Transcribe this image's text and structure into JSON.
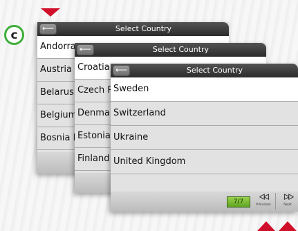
{
  "step_label": "c",
  "back_glyph": "⟵",
  "panels": [
    {
      "title": "Select Country",
      "rows": [
        "Andorra",
        "Austria",
        "Belarus",
        "Belgium",
        "Bosnia I"
      ]
    },
    {
      "title": "Select Country",
      "rows": [
        "Croatia",
        "Czech R",
        "Denmar",
        "Estonia",
        "Finland"
      ]
    },
    {
      "title": "Select Country",
      "rows": [
        "Sweden",
        "Switzerland",
        "Ukraine",
        "United Kingdom"
      ]
    }
  ],
  "pager": {
    "count": "7/7",
    "prev_glyph": "ᐊᐊ",
    "prev_label": "Previous",
    "next_glyph": "ᐅᐅ",
    "next_label": "Next"
  },
  "colors": {
    "accent_red": "#d0102a",
    "badge_green": "#3fae3a",
    "counter_green": "#7cc03a"
  }
}
